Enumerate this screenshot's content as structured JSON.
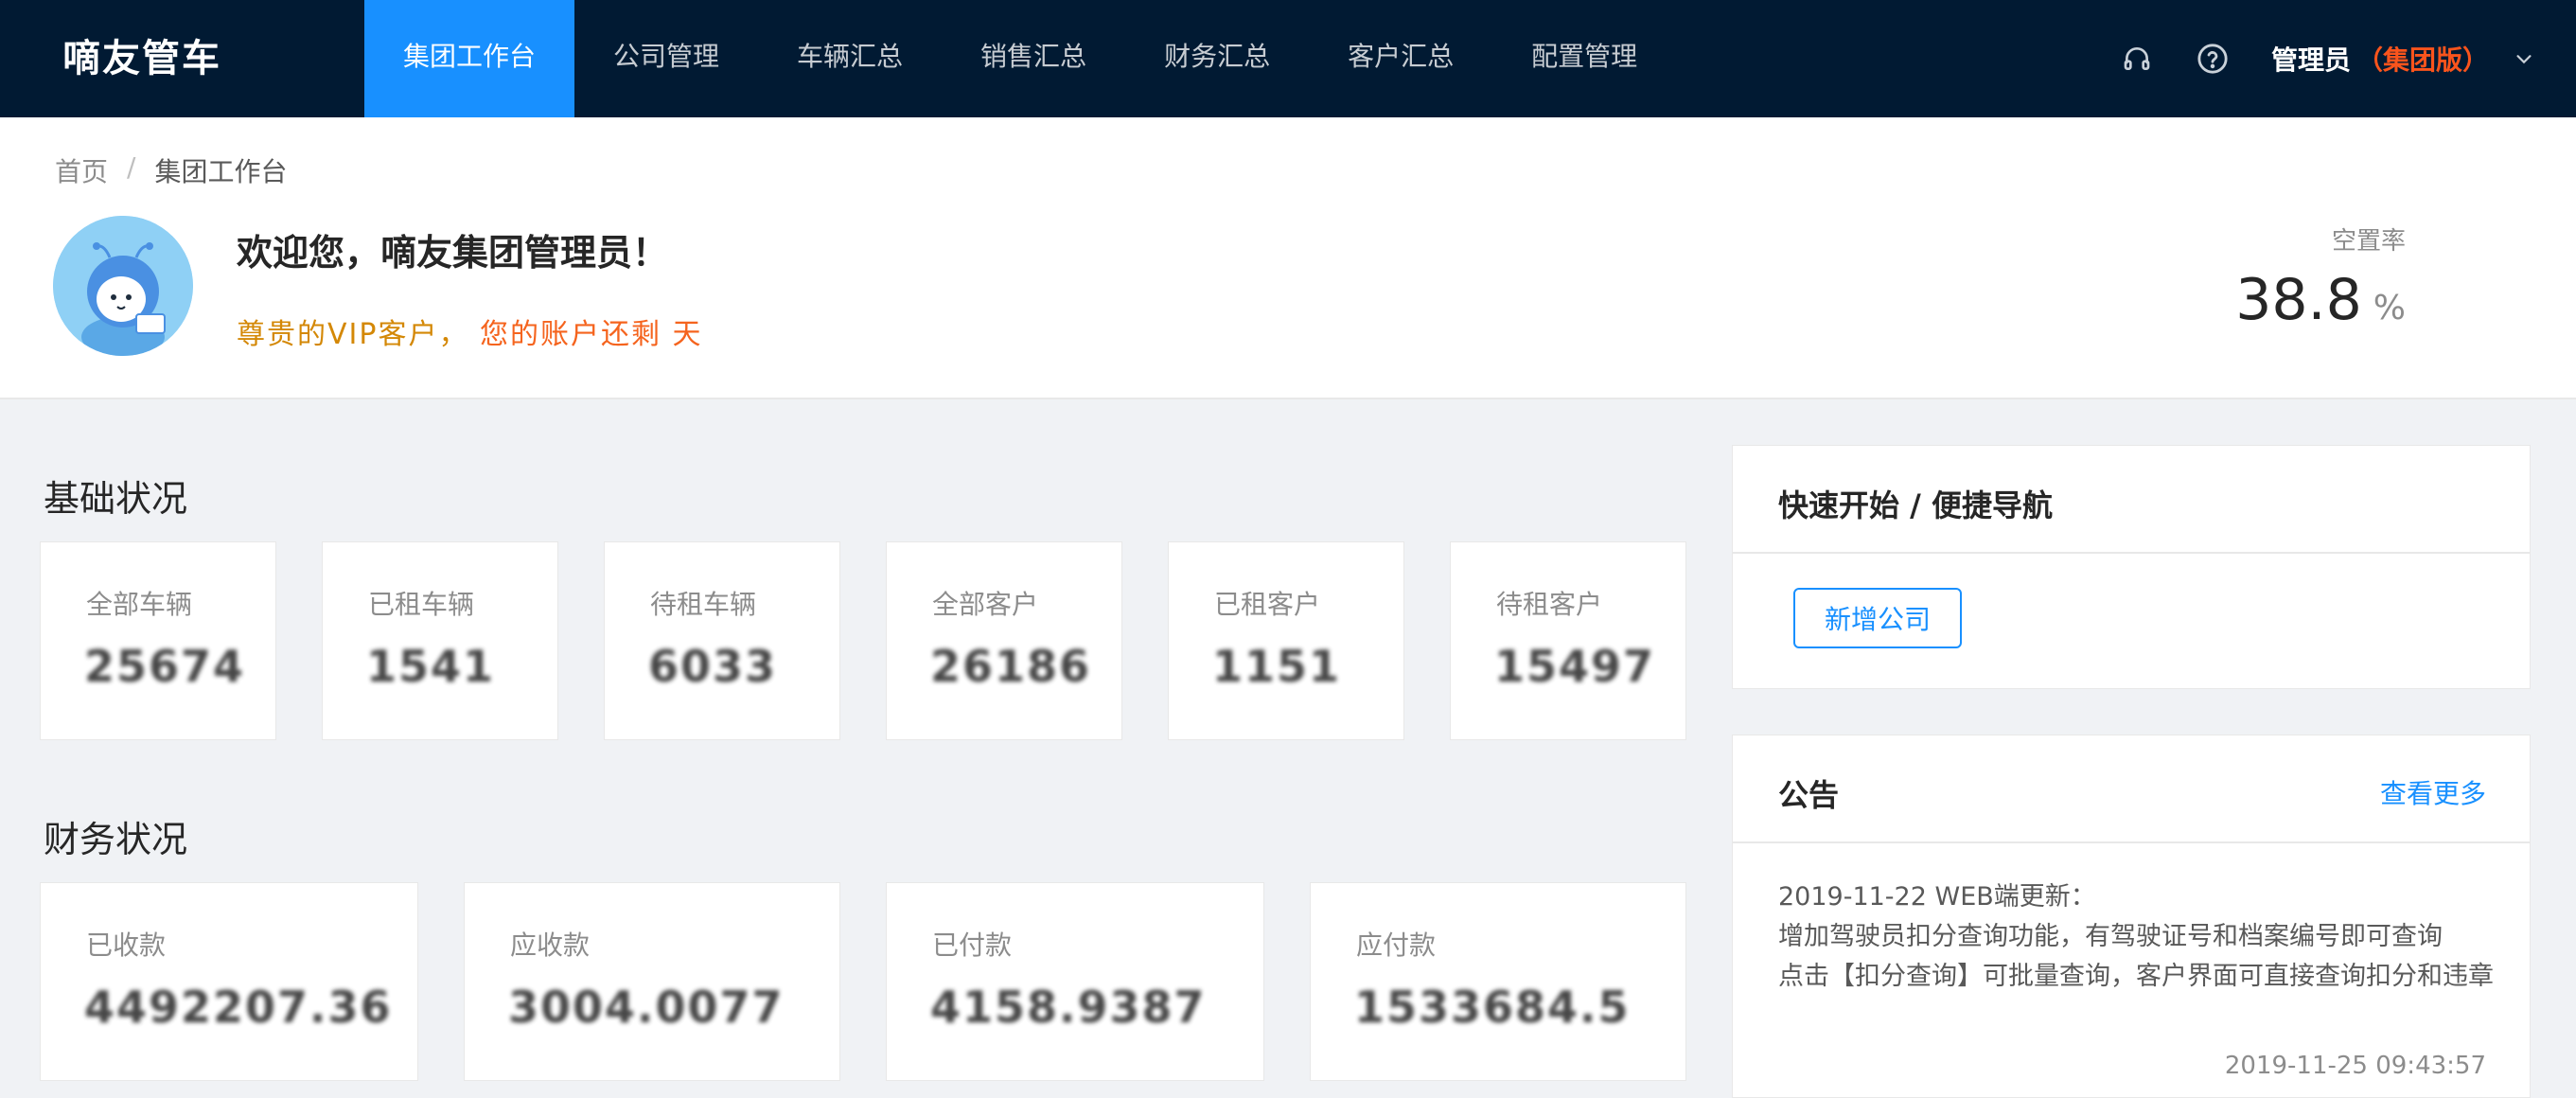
{
  "brand": {
    "logo_text": "嘀友管车"
  },
  "nav": {
    "items": [
      {
        "label": "集团工作台",
        "active": true
      },
      {
        "label": "公司管理",
        "active": false
      },
      {
        "label": "车辆汇总",
        "active": false
      },
      {
        "label": "销售汇总",
        "active": false
      },
      {
        "label": "财务汇总",
        "active": false
      },
      {
        "label": "客户汇总",
        "active": false
      },
      {
        "label": "配置管理",
        "active": false
      }
    ]
  },
  "topbar": {
    "icons": [
      "headset-icon",
      "help-circle-icon"
    ],
    "user_name": "管理员",
    "user_edition": "（集团版）",
    "dropdown_icon": "chevron-down-icon"
  },
  "breadcrumb": {
    "home": "首页",
    "separator": "/",
    "current": "集团工作台"
  },
  "welcome": {
    "title": "欢迎您，嘀友集团管理员！",
    "vip_text": "尊贵的VIP客户，",
    "remain_text": "您的账户还剩  天"
  },
  "vacancy": {
    "label": "空置率",
    "value": "38.8",
    "unit": "%"
  },
  "basic_status": {
    "title": "基础状况",
    "cards": [
      {
        "label": "全部车辆",
        "value": "25674"
      },
      {
        "label": "已租车辆",
        "value": "1541"
      },
      {
        "label": "待租车辆",
        "value": "6033"
      },
      {
        "label": "全部客户",
        "value": "26186"
      },
      {
        "label": "已租客户",
        "value": "1151"
      },
      {
        "label": "待租客户",
        "value": "15497"
      }
    ]
  },
  "finance_status": {
    "title": "财务状况",
    "cards": [
      {
        "label": "已收款",
        "value": "4492207.36"
      },
      {
        "label": "应收款",
        "value": "3004.0077"
      },
      {
        "label": "已付款",
        "value": "4158.9387"
      },
      {
        "label": "应付款",
        "value": "1533684.5"
      }
    ]
  },
  "quick_nav": {
    "title": "快速开始 / 便捷导航",
    "button_label": "新增公司"
  },
  "notice": {
    "title": "公告",
    "more_label": "查看更多",
    "lines": [
      "2019-11-22 WEB端更新：",
      "增加驾驶员扣分查询功能，有驾驶证号和档案编号即可查询",
      "点击【扣分查询】可批量查询，客户界面可直接查询扣分和违章"
    ],
    "time": "2019-11-25 09:43:57"
  },
  "colors": {
    "nav_bg": "#011a33",
    "accent": "#1890ff",
    "vip": "#d48806",
    "warning": "#f5641e"
  }
}
